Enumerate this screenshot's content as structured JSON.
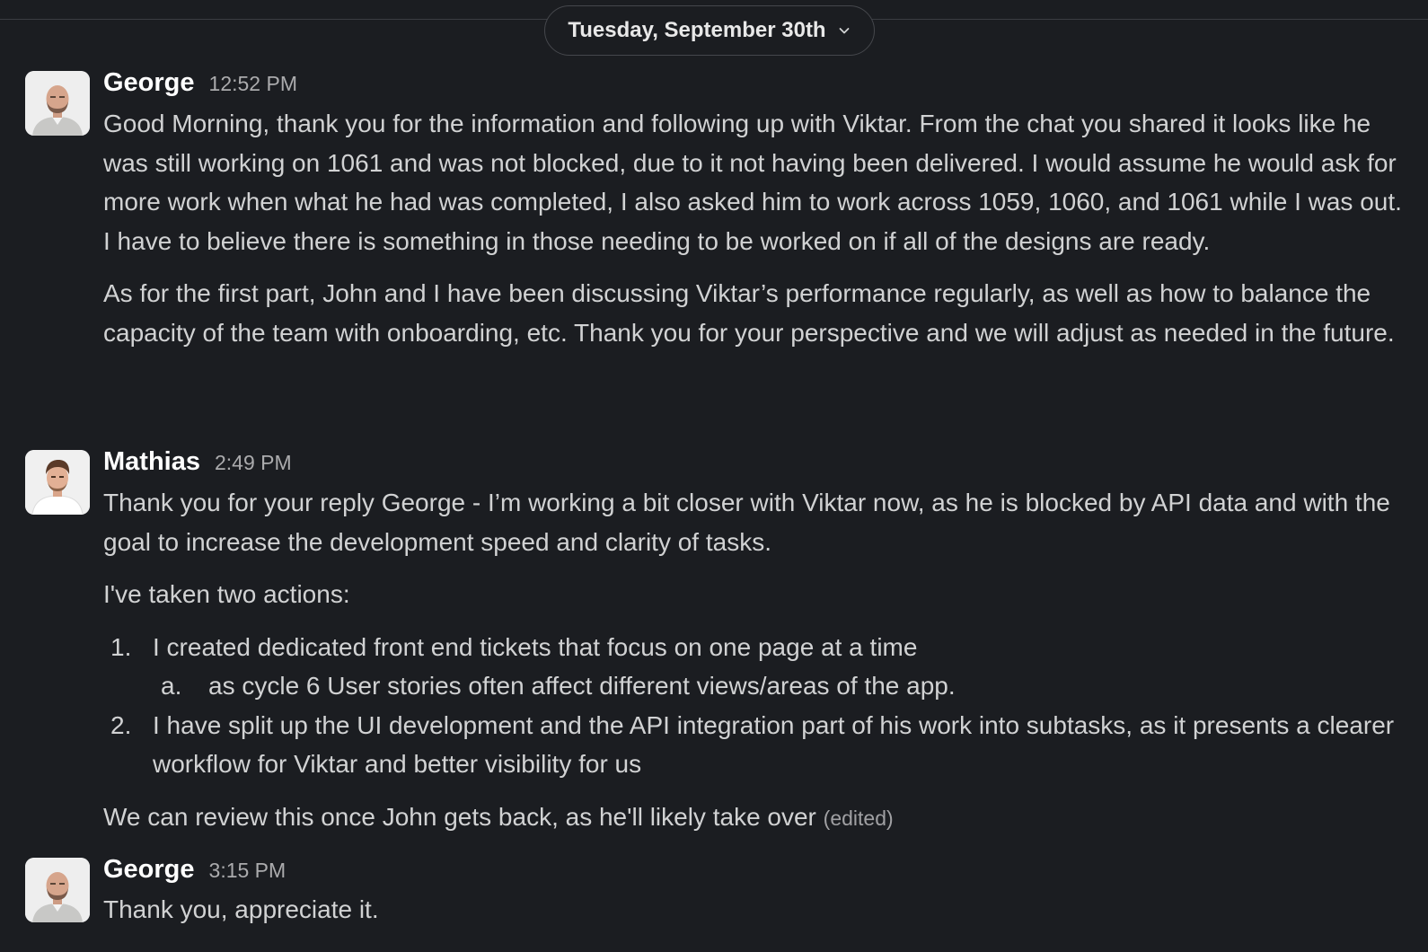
{
  "date_divider": {
    "label": "Tuesday, September 30th"
  },
  "messages": [
    {
      "author": "George",
      "time": "12:52 PM",
      "paragraphs": [
        "Good Morning, thank you for the information and following up with Viktar. From the chat you shared it looks like he was still working on 1061 and was not blocked, due to it not having been delivered. I would assume he would ask for more work when what he had was completed, I also asked him to work across 1059, 1060, and 1061 while I was out. I have to believe there is something in those needing to be worked on if all of the designs are ready.",
        "As for the first part, John and I have been discussing Viktar’s performance regularly, as well as how to balance the capacity of the team with onboarding, etc. Thank you for your perspective and we will adjust as needed in the future."
      ]
    },
    {
      "author": "Mathias",
      "time": "2:49 PM",
      "paragraphs": [
        "Thank you for your reply George - I’m working a bit closer with Viktar now, as he is blocked by API data and with the goal to increase the development speed and clarity of tasks.",
        "I've taken two actions:"
      ],
      "list": [
        {
          "num": "1.",
          "text": "I created dedicated front end tickets that focus on one page at a time",
          "sub": {
            "letter": "a.",
            "text": "as cycle 6 User stories often affect different views/areas of the app."
          }
        },
        {
          "num": "2.",
          "text": "I have split up the UI development and the API integration part of his work into subtasks, as it presents a clearer workflow for Viktar and better visibility for us"
        }
      ],
      "closing": "We can review this once John gets back, as he'll likely take over",
      "edited_label": "(edited)"
    },
    {
      "author": "George",
      "time": "3:15 PM",
      "paragraphs": [
        "Thank you, appreciate it."
      ]
    }
  ],
  "colors": {
    "background": "#1b1d21",
    "text": "#d1d2d3",
    "author": "#ffffff",
    "timestamp": "#ababad"
  },
  "icons": {
    "date_dropdown": "chevron-down-icon"
  }
}
